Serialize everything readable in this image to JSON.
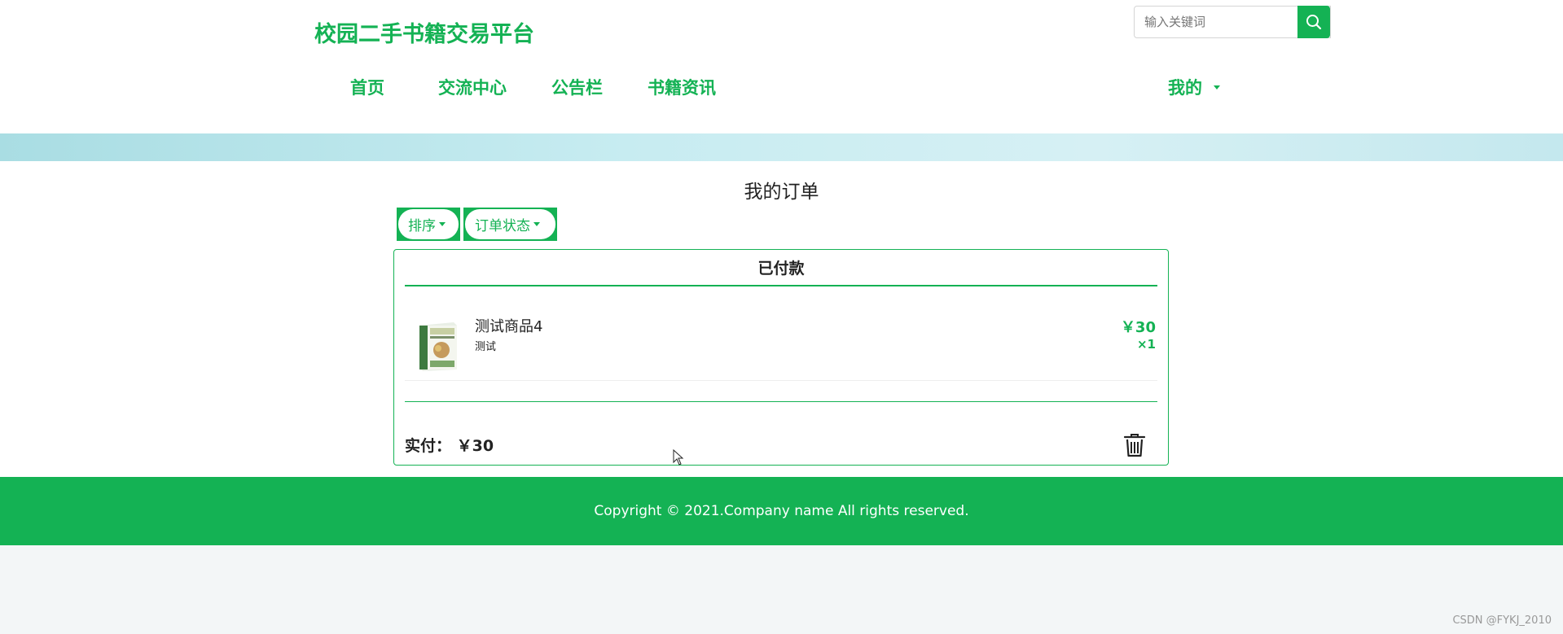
{
  "header": {
    "site_title": "校园二手书籍交易平台",
    "search_placeholder": "输入关键词",
    "nav": {
      "home": "首页",
      "exchange": "交流中心",
      "notice": "公告栏",
      "news": "书籍资讯",
      "mine": "我的"
    }
  },
  "main": {
    "page_title": "我的订单",
    "filters": {
      "sort": "排序",
      "status": "订单状态"
    },
    "order": {
      "status": "已付款",
      "item": {
        "name": "测试商品4",
        "desc": "测试",
        "price": "￥30",
        "qty": "×1"
      },
      "paid_label": "实付：",
      "paid_amount": "￥30"
    }
  },
  "footer": {
    "copyright": "Copyright © 2021.Company name All rights reserved."
  },
  "watermark": "CSDN @FYKJ_2010",
  "colors": {
    "accent": "#14b254"
  }
}
